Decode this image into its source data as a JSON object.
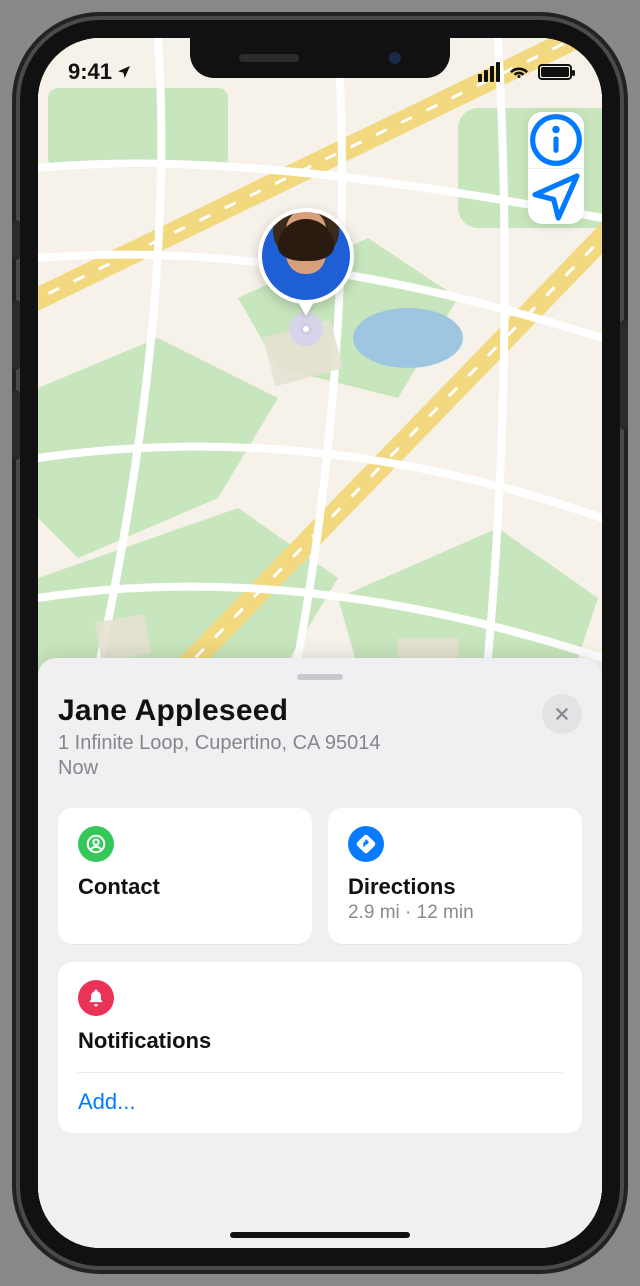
{
  "status": {
    "time": "9:41",
    "location_services": true
  },
  "map_controls": {
    "info": "info-icon",
    "locate": "location-arrow-icon"
  },
  "person": {
    "name": "Jane Appleseed",
    "address": "1 Infinite Loop, Cupertino, CA 95014",
    "timestamp": "Now"
  },
  "actions": {
    "contact": {
      "label": "Contact"
    },
    "directions": {
      "label": "Directions",
      "subtitle": "2.9 mi · 12 min"
    }
  },
  "notifications": {
    "title": "Notifications",
    "add_label": "Add..."
  }
}
